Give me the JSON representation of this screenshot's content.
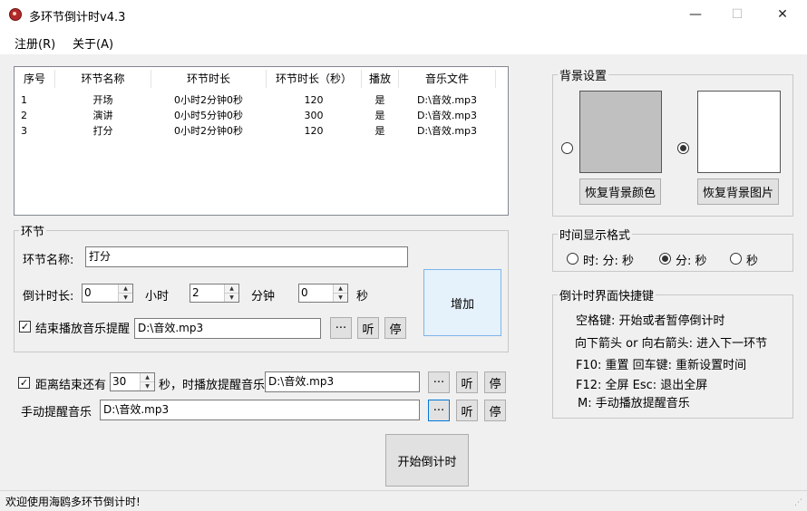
{
  "window": {
    "title": "多环节倒计时v4.3",
    "minimize": "—",
    "maximize": "☐",
    "close": "✕"
  },
  "menu": {
    "register": "注册(R)",
    "about": "关于(A)"
  },
  "table": {
    "columns": [
      "序号",
      "环节名称",
      "环节时长",
      "环节时长（秒）",
      "播放",
      "音乐文件"
    ],
    "rows": [
      [
        "1",
        "开场",
        "0小时2分钟0秒",
        "120",
        "是",
        "D:\\音效.mp3"
      ],
      [
        "2",
        "演讲",
        "0小时5分钟0秒",
        "300",
        "是",
        "D:\\音效.mp3"
      ],
      [
        "3",
        "打分",
        "0小时2分钟0秒",
        "120",
        "是",
        "D:\\音效.mp3"
      ]
    ]
  },
  "segment": {
    "group_title": "环节",
    "name_label": "环节名称:",
    "name_value": "打分",
    "countdown_label": "倒计时长:",
    "hours_value": "0",
    "hours_unit": "小时",
    "minutes_value": "2",
    "minutes_unit": "分钟",
    "seconds_value": "0",
    "seconds_unit": "秒",
    "play_music_label": "结束播放音乐提醒",
    "play_music_checked": "✓",
    "music_path": "D:\\音效.mp3",
    "browse": "···",
    "listen": "听",
    "stop": "停",
    "add_button": "增加"
  },
  "reminder": {
    "label_prefix": "距离结束还有",
    "checked": "✓",
    "seconds_value": "30",
    "label_suffix": "秒，时播放提醒音乐",
    "music_path": "D:\\音效.mp3",
    "browse": "···",
    "listen": "听",
    "stop": "停"
  },
  "manual": {
    "label": "手动提醒音乐",
    "music_path": "D:\\音效.mp3",
    "browse": "···",
    "listen": "听",
    "stop": "停"
  },
  "start_button": "开始倒计时",
  "background": {
    "group_title": "背景设置",
    "color_swatch": "#c0c0c0",
    "image_swatch": "#ffffff",
    "restore_color": "恢复背景颜色",
    "restore_image": "恢复背景图片"
  },
  "time_format": {
    "group_title": "时间显示格式",
    "options": [
      "时: 分: 秒",
      "分: 秒",
      "秒"
    ],
    "selected": "分: 秒"
  },
  "shortcuts": {
    "group_title": "倒计时界面快捷键",
    "lines": [
      "空格键: 开始或者暂停倒计时",
      "向下箭头 or 向右箭头: 进入下一环节",
      "F10: 重置    回车键: 重新设置时间",
      "F12: 全屏    Esc: 退出全屏",
      "M: 手动播放提醒音乐"
    ]
  },
  "status": "欢迎使用海鸥多环节倒计时!"
}
